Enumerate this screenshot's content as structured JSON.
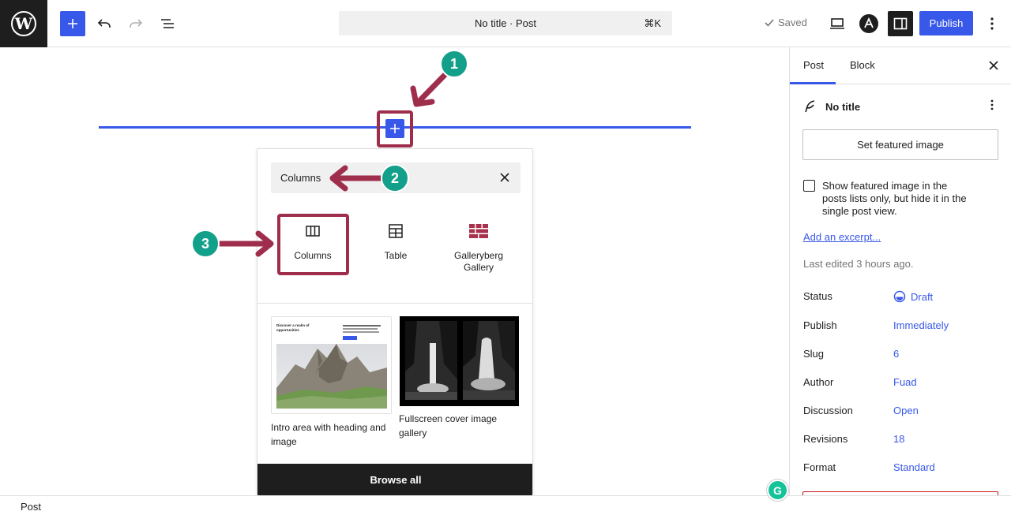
{
  "toolbar": {
    "title": "No title · Post",
    "shortcut": "⌘K",
    "saved_label": "Saved",
    "publish_label": "Publish"
  },
  "inserter": {
    "search_value": "Columns",
    "blocks": [
      {
        "label": "Columns"
      },
      {
        "label": "Table"
      },
      {
        "label": "Galleryberg Gallery"
      }
    ],
    "patterns": [
      {
        "label": "Intro area with heading and image",
        "thumb_heading": "Discover a realm of opportunities"
      },
      {
        "label": "Fullscreen cover image gallery"
      }
    ],
    "browse_all": "Browse all"
  },
  "annotations": {
    "step1": "1",
    "step2": "2",
    "step3": "3",
    "color": "#9f2e4c",
    "badge_color": "#13a08a"
  },
  "sidebar": {
    "tabs": [
      "Post",
      "Block"
    ],
    "post_title": "No title",
    "featured_button": "Set featured image",
    "checkbox_label": "Show featured image in the posts lists only, but hide it in the single post view.",
    "excerpt_link": "Add an excerpt...",
    "last_edited": "Last edited 3 hours ago.",
    "meta": [
      {
        "label": "Status",
        "value": "Draft"
      },
      {
        "label": "Publish",
        "value": "Immediately"
      },
      {
        "label": "Slug",
        "value": "6"
      },
      {
        "label": "Author",
        "value": "Fuad"
      },
      {
        "label": "Discussion",
        "value": "Open"
      },
      {
        "label": "Revisions",
        "value": "18"
      },
      {
        "label": "Format",
        "value": "Standard"
      }
    ]
  },
  "footer": {
    "breadcrumb": "Post"
  },
  "grammarly_letter": "G"
}
